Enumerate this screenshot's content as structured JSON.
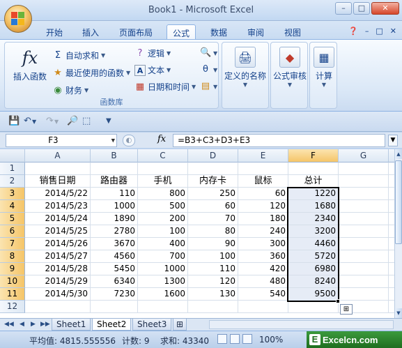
{
  "window": {
    "title": "Book1 - Microsoft Excel"
  },
  "tabs": [
    "开始",
    "插入",
    "页面布局",
    "公式",
    "数据",
    "审阅",
    "视图"
  ],
  "active_tab": "公式",
  "ribbon": {
    "insert_function": "插入函数",
    "autosum": "自动求和",
    "recent": "最近使用的函数",
    "financial": "财务",
    "logical": "逻辑",
    "text": "文本",
    "datetime": "日期和时间",
    "group_label": "函数库",
    "defined_names": "定义的名称",
    "formula_audit": "公式审核",
    "calculation": "计算"
  },
  "formula_bar": {
    "name_box": "F3",
    "fx": "fx",
    "formula": "=B3+C3+D3+E3"
  },
  "columns": [
    "A",
    "B",
    "C",
    "D",
    "E",
    "F",
    "G"
  ],
  "rows": [
    "1",
    "2",
    "3",
    "4",
    "5",
    "6",
    "7",
    "8",
    "9",
    "10",
    "11",
    "12"
  ],
  "headers": [
    "销售日期",
    "路由器",
    "手机",
    "内存卡",
    "鼠标",
    "总计"
  ],
  "data": [
    [
      "2014/5/22",
      "110",
      "800",
      "250",
      "60",
      "1220"
    ],
    [
      "2014/5/23",
      "1000",
      "500",
      "60",
      "120",
      "1680"
    ],
    [
      "2014/5/24",
      "1890",
      "200",
      "70",
      "180",
      "2340"
    ],
    [
      "2014/5/25",
      "2780",
      "100",
      "80",
      "240",
      "3200"
    ],
    [
      "2014/5/26",
      "3670",
      "400",
      "90",
      "300",
      "4460"
    ],
    [
      "2014/5/27",
      "4560",
      "700",
      "100",
      "360",
      "5720"
    ],
    [
      "2014/5/28",
      "5450",
      "1000",
      "110",
      "420",
      "6980"
    ],
    [
      "2014/5/29",
      "6340",
      "1300",
      "120",
      "480",
      "8240"
    ],
    [
      "2014/5/30",
      "7230",
      "1600",
      "130",
      "540",
      "9500"
    ]
  ],
  "sheets": [
    "Sheet1",
    "Sheet2",
    "Sheet3"
  ],
  "active_sheet": "Sheet2",
  "status": {
    "average": "平均值: 4815.555556",
    "count": "计数: 9",
    "sum": "求和: 43340",
    "zoom": "100%"
  },
  "watermark": "Excelcn.com",
  "colors": {
    "accent": "#15428b",
    "selection_header": "#f5c568",
    "ribbon_bg": "#dbe8f7"
  }
}
